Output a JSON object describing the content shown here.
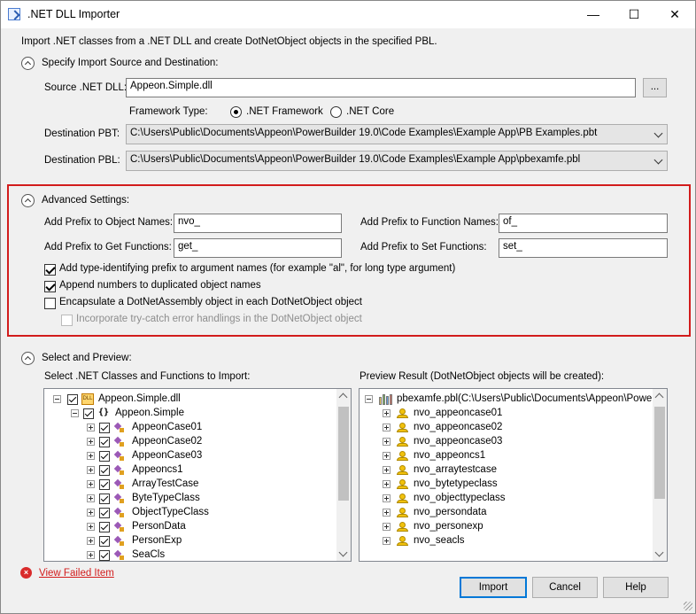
{
  "window": {
    "title": ".NET DLL Importer",
    "minimize": "—",
    "maximize": "☐",
    "close": "✕"
  },
  "intro": "Import .NET classes from a .NET DLL and create DotNetObject objects in the specified PBL.",
  "source_section": {
    "header": "Specify Import Source and Destination:",
    "source_label": "Source .NET DLL:",
    "source_value": "Appeon.Simple.dll",
    "browse_label": "...",
    "framework_label": "Framework Type:",
    "framework_options": [
      ".NET Framework",
      ".NET Core"
    ],
    "framework_selected": ".NET Framework",
    "pbt_label": "Destination PBT:",
    "pbt_value": "C:\\Users\\Public\\Documents\\Appeon\\PowerBuilder 19.0\\Code Examples\\Example App\\PB Examples.pbt",
    "pbl_label": "Destination PBL:",
    "pbl_value": "C:\\Users\\Public\\Documents\\Appeon\\PowerBuilder 19.0\\Code Examples\\Example App\\pbexamfe.pbl"
  },
  "advanced": {
    "header": "Advanced Settings:",
    "object_prefix_label": "Add Prefix to Object Names:",
    "object_prefix": "nvo_",
    "function_prefix_label": "Add Prefix to Function Names:",
    "function_prefix": "of_",
    "get_prefix_label": "Add Prefix to Get Functions:",
    "get_prefix": "get_",
    "set_prefix_label": "Add Prefix to Set Functions:",
    "set_prefix": "set_",
    "options": [
      {
        "label": "Add type-identifying prefix to argument names (for example \"al\", for long type argument)",
        "checked": true,
        "enabled": true
      },
      {
        "label": "Append numbers to duplicated object names",
        "checked": true,
        "enabled": true
      },
      {
        "label": "Encapsulate a DotNetAssembly object in each DotNetObject object",
        "checked": false,
        "enabled": true
      },
      {
        "label": "Incorporate try-catch error handlings in the DotNetObject object",
        "checked": false,
        "enabled": false
      }
    ]
  },
  "preview": {
    "header": "Select and Preview:",
    "left_label": "Select .NET Classes and Functions to Import:",
    "right_label": "Preview Result (DotNetObject objects will be created):",
    "dll_name": "Appeon.Simple.dll",
    "namespace": "Appeon.Simple",
    "namespace_icon": "{}",
    "dll_icon_text": "DLL",
    "classes": [
      "AppeonCase01",
      "AppeonCase02",
      "AppeonCase03",
      "Appeoncs1",
      "ArrayTestCase",
      "ByteTypeClass",
      "ObjectTypeClass",
      "PersonData",
      "PersonExp",
      "SeaCls"
    ],
    "pbl_root": "pbexamfe.pbl(C:\\Users\\Public\\Documents\\Appeon\\PowerBu",
    "objects": [
      "nvo_appeoncase01",
      "nvo_appeoncase02",
      "nvo_appeoncase03",
      "nvo_appeoncs1",
      "nvo_arraytestcase",
      "nvo_bytetypeclass",
      "nvo_objecttypeclass",
      "nvo_persondata",
      "nvo_personexp",
      "nvo_seacls"
    ]
  },
  "footer": {
    "error_icon": "×",
    "view_failed": "View Failed Item",
    "import": "Import",
    "cancel": "Cancel",
    "help": "Help"
  }
}
